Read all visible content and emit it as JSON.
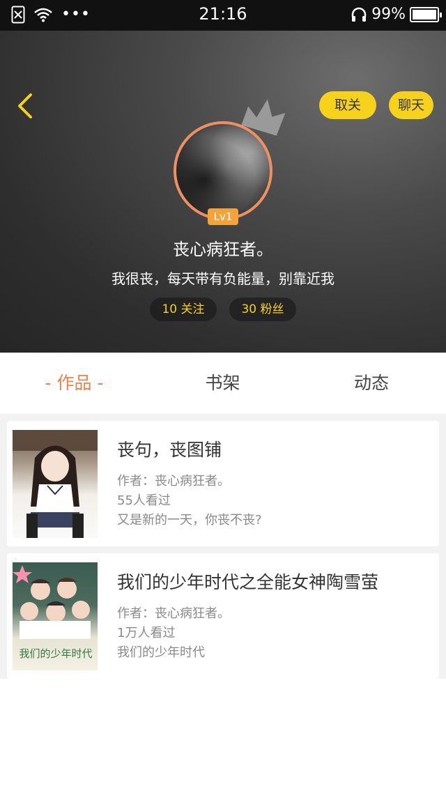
{
  "status_bar": {
    "time": "21:16",
    "battery_text": "99%",
    "battery_level": 0.99,
    "icons": [
      "no-sim-icon",
      "wifi-icon",
      "more-dots-icon",
      "headphones-icon",
      "battery-icon"
    ]
  },
  "header": {
    "follow_label": "取关",
    "chat_label": "聊天",
    "level": "Lv1",
    "username": "丧心病狂者。",
    "bio": "我很丧，每天带有负能量，别靠近我",
    "follow_count_label": "10 关注",
    "fans_count_label": "30 粉丝",
    "accent_color": "#f6d21b"
  },
  "tabs": [
    {
      "label": "- 作品 -"
    },
    {
      "label": "书架"
    },
    {
      "label": "动态"
    }
  ],
  "works": [
    {
      "title": "丧句，丧图铺",
      "author": "作者：丧心病狂者。",
      "views": "55人看过",
      "desc": "又是新的一天，你丧不丧?"
    },
    {
      "title": "我们的少年时代之全能女神陶雪萤",
      "author": "作者：丧心病狂者。",
      "views": "1万人看过",
      "desc": "我们的少年时代"
    }
  ],
  "cover_art_text": "我们的少年时代"
}
